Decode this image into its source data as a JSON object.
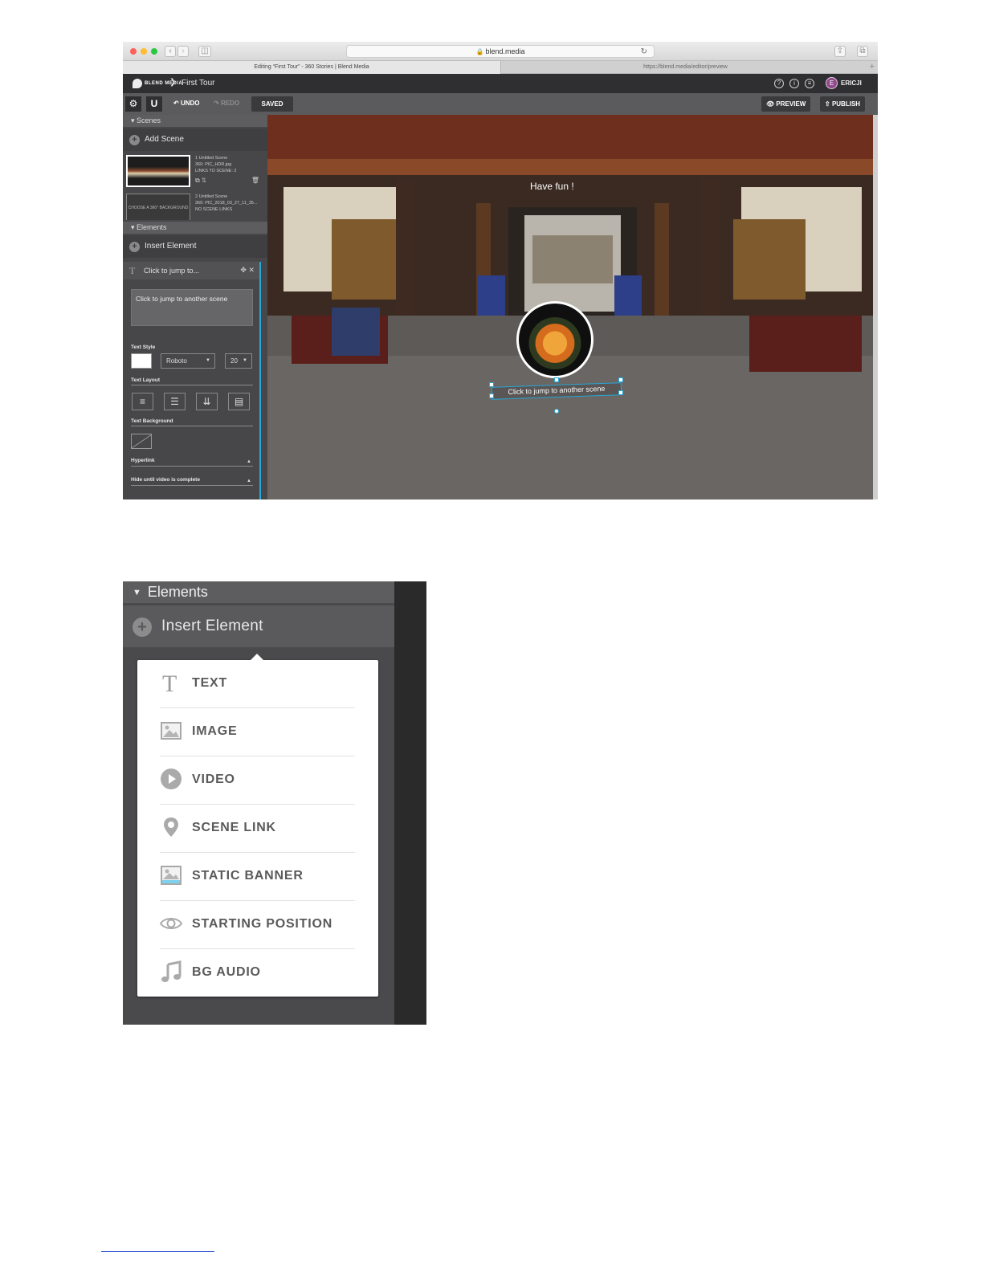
{
  "browser": {
    "url": "blend.media",
    "tabs": [
      {
        "title": "Editing “First Tour” - 360 Stories | Blend Media"
      },
      {
        "title": "https://blend.media/editor/preview"
      }
    ],
    "traffic_light_colors": [
      "#fe5f57",
      "#febc2e",
      "#28c840"
    ]
  },
  "app": {
    "logo_text": "BLEND MEDIA",
    "project_title": "First Tour",
    "user_initial": "E",
    "user_name": "ERICJI",
    "avatar_color": "#8e4a8a"
  },
  "toolbar": {
    "undo_label": "UNDO",
    "redo_label": "REDO",
    "saved_label": "SAVED",
    "preview_label": "PREVIEW",
    "publish_label": "PUBLISH"
  },
  "sidebar": {
    "scenes_header": "Scenes",
    "add_scene_label": "Add Scene",
    "scenes": [
      {
        "line1": "1 Untitled Scene",
        "line2": "360: PIC_HDR.jpg",
        "line3": "LINKS TO SCENE: 2"
      },
      {
        "line1": "2 Untitled Scene",
        "line2": "360: PIC_2018_03_27_11_35...",
        "line3": "NO SCENE LINKS",
        "placeholder": "CHOOSE A 360° BACKGROUND"
      }
    ],
    "elements_header": "Elements",
    "insert_element_label": "Insert Element",
    "selected_element_label": "Click to jump to...",
    "text_content": "Click to jump to another scene",
    "text_style_label": "Text Style",
    "font_value": "Roboto",
    "size_value": "20",
    "text_layout_label": "Text Layout",
    "text_background_label": "Text Background",
    "hyperlink_label": "Hyperlink",
    "hide_label": "Hide until video is complete"
  },
  "viewport": {
    "overlay_text": "Have fun !",
    "hotspot_label": "Click to jump to another scene",
    "accent_color": "#2aa7d7"
  },
  "zoom_panel": {
    "elements_header": "Elements",
    "insert_element_label": "Insert Element",
    "menu_items": [
      {
        "label": "TEXT",
        "icon": "text-icon"
      },
      {
        "label": "IMAGE",
        "icon": "image-icon"
      },
      {
        "label": "VIDEO",
        "icon": "video-icon"
      },
      {
        "label": "SCENE LINK",
        "icon": "map-pin-icon"
      },
      {
        "label": "STATIC BANNER",
        "icon": "banner-icon"
      },
      {
        "label": "STARTING POSITION",
        "icon": "eye-icon"
      },
      {
        "label": "BG AUDIO",
        "icon": "music-note-icon"
      }
    ]
  }
}
